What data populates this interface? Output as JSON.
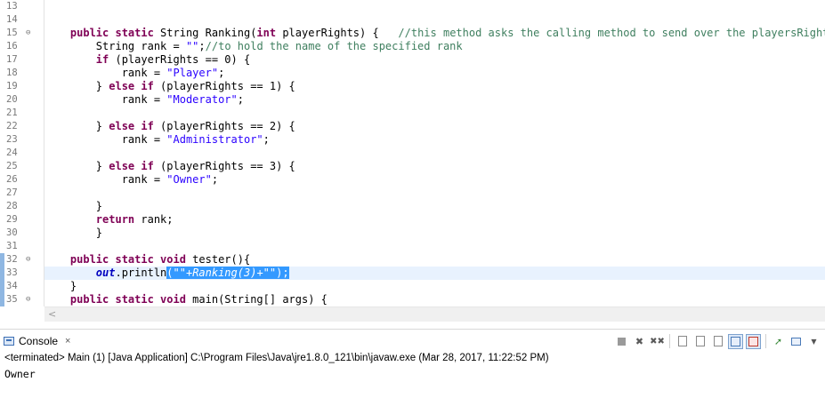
{
  "editor": {
    "line_numbers": [
      "13",
      "14",
      "15",
      "16",
      "17",
      "18",
      "19",
      "20",
      "21",
      "22",
      "23",
      "24",
      "25",
      "26",
      "27",
      "28",
      "29",
      "30",
      "31",
      "32",
      "33",
      "34",
      "35"
    ],
    "lines": [
      [],
      [],
      [
        {
          "t": "    "
        },
        {
          "t": "public static",
          "c": "kw"
        },
        {
          "t": " String Ranking("
        },
        {
          "t": "int",
          "c": "kw"
        },
        {
          "t": " playerRights) {   "
        },
        {
          "t": "//this method asks the calling method to send over the playersRights",
          "c": "cmt"
        }
      ],
      [
        {
          "t": "        String rank = "
        },
        {
          "t": "\"\"",
          "c": "str"
        },
        {
          "t": ";"
        },
        {
          "t": "//to hold the name of the specified rank",
          "c": "cmt"
        }
      ],
      [
        {
          "t": "        "
        },
        {
          "t": "if",
          "c": "kw"
        },
        {
          "t": " (playerRights == 0) {"
        }
      ],
      [
        {
          "t": "            rank = "
        },
        {
          "t": "\"Player\"",
          "c": "str"
        },
        {
          "t": ";"
        }
      ],
      [
        {
          "t": "        } "
        },
        {
          "t": "else if",
          "c": "kw"
        },
        {
          "t": " (playerRights == 1) {"
        }
      ],
      [
        {
          "t": "            rank = "
        },
        {
          "t": "\"Moderator\"",
          "c": "str"
        },
        {
          "t": ";"
        }
      ],
      [],
      [
        {
          "t": "        } "
        },
        {
          "t": "else if",
          "c": "kw"
        },
        {
          "t": " (playerRights == 2) {"
        }
      ],
      [
        {
          "t": "            rank = "
        },
        {
          "t": "\"Administrator\"",
          "c": "str"
        },
        {
          "t": ";"
        }
      ],
      [],
      [
        {
          "t": "        } "
        },
        {
          "t": "else if",
          "c": "kw"
        },
        {
          "t": " (playerRights == 3) {"
        }
      ],
      [
        {
          "t": "            rank = "
        },
        {
          "t": "\"Owner\"",
          "c": "str"
        },
        {
          "t": ";"
        }
      ],
      [],
      [
        {
          "t": "        }"
        }
      ],
      [
        {
          "t": "        "
        },
        {
          "t": "return",
          "c": "kw"
        },
        {
          "t": " rank;"
        }
      ],
      [
        {
          "t": "        }"
        }
      ],
      [],
      [
        {
          "t": "    "
        },
        {
          "t": "public static void",
          "c": "kw"
        },
        {
          "t": " tester(){"
        }
      ],
      [
        {
          "t": "        "
        },
        {
          "t": "out",
          "c": "fld"
        },
        {
          "t": ".println"
        },
        {
          "t": "(\"\"+Ranking(3)+\"\");",
          "c": "sel"
        }
      ],
      [
        {
          "t": "    }"
        }
      ],
      [
        {
          "t": "    "
        },
        {
          "t": "public static void",
          "c": "kw"
        },
        {
          "t": " main(String[] args) {"
        }
      ]
    ],
    "fold_lines": [
      "15",
      "32",
      "35"
    ],
    "marked_lines": [
      "32",
      "33",
      "34",
      "35"
    ],
    "current_line": "33"
  },
  "console": {
    "tab_label": "Console",
    "close_icon": "×",
    "status": "<terminated> Main (1) [Java Application] C:\\Program Files\\Java\\jre1.8.0_121\\bin\\javaw.exe (Mar 28, 2017, 11:22:52 PM)",
    "output": "Owner",
    "toolbar": [
      "terminate-icon",
      "remove-launch-icon",
      "remove-all-terminated-icon",
      "scroll-lock-icon",
      "word-wrap-icon",
      "show-console-on-output-icon",
      "show-console-on-error-icon",
      "display-selected-console-icon",
      "open-console-icon",
      "view-menu-icon"
    ]
  },
  "colors": {
    "keyword": "#7f0055",
    "string": "#2a00ff",
    "comment": "#3f7f5f",
    "field": "#0000c0",
    "selection": "#3399ff",
    "current_line": "#e8f2fe"
  }
}
